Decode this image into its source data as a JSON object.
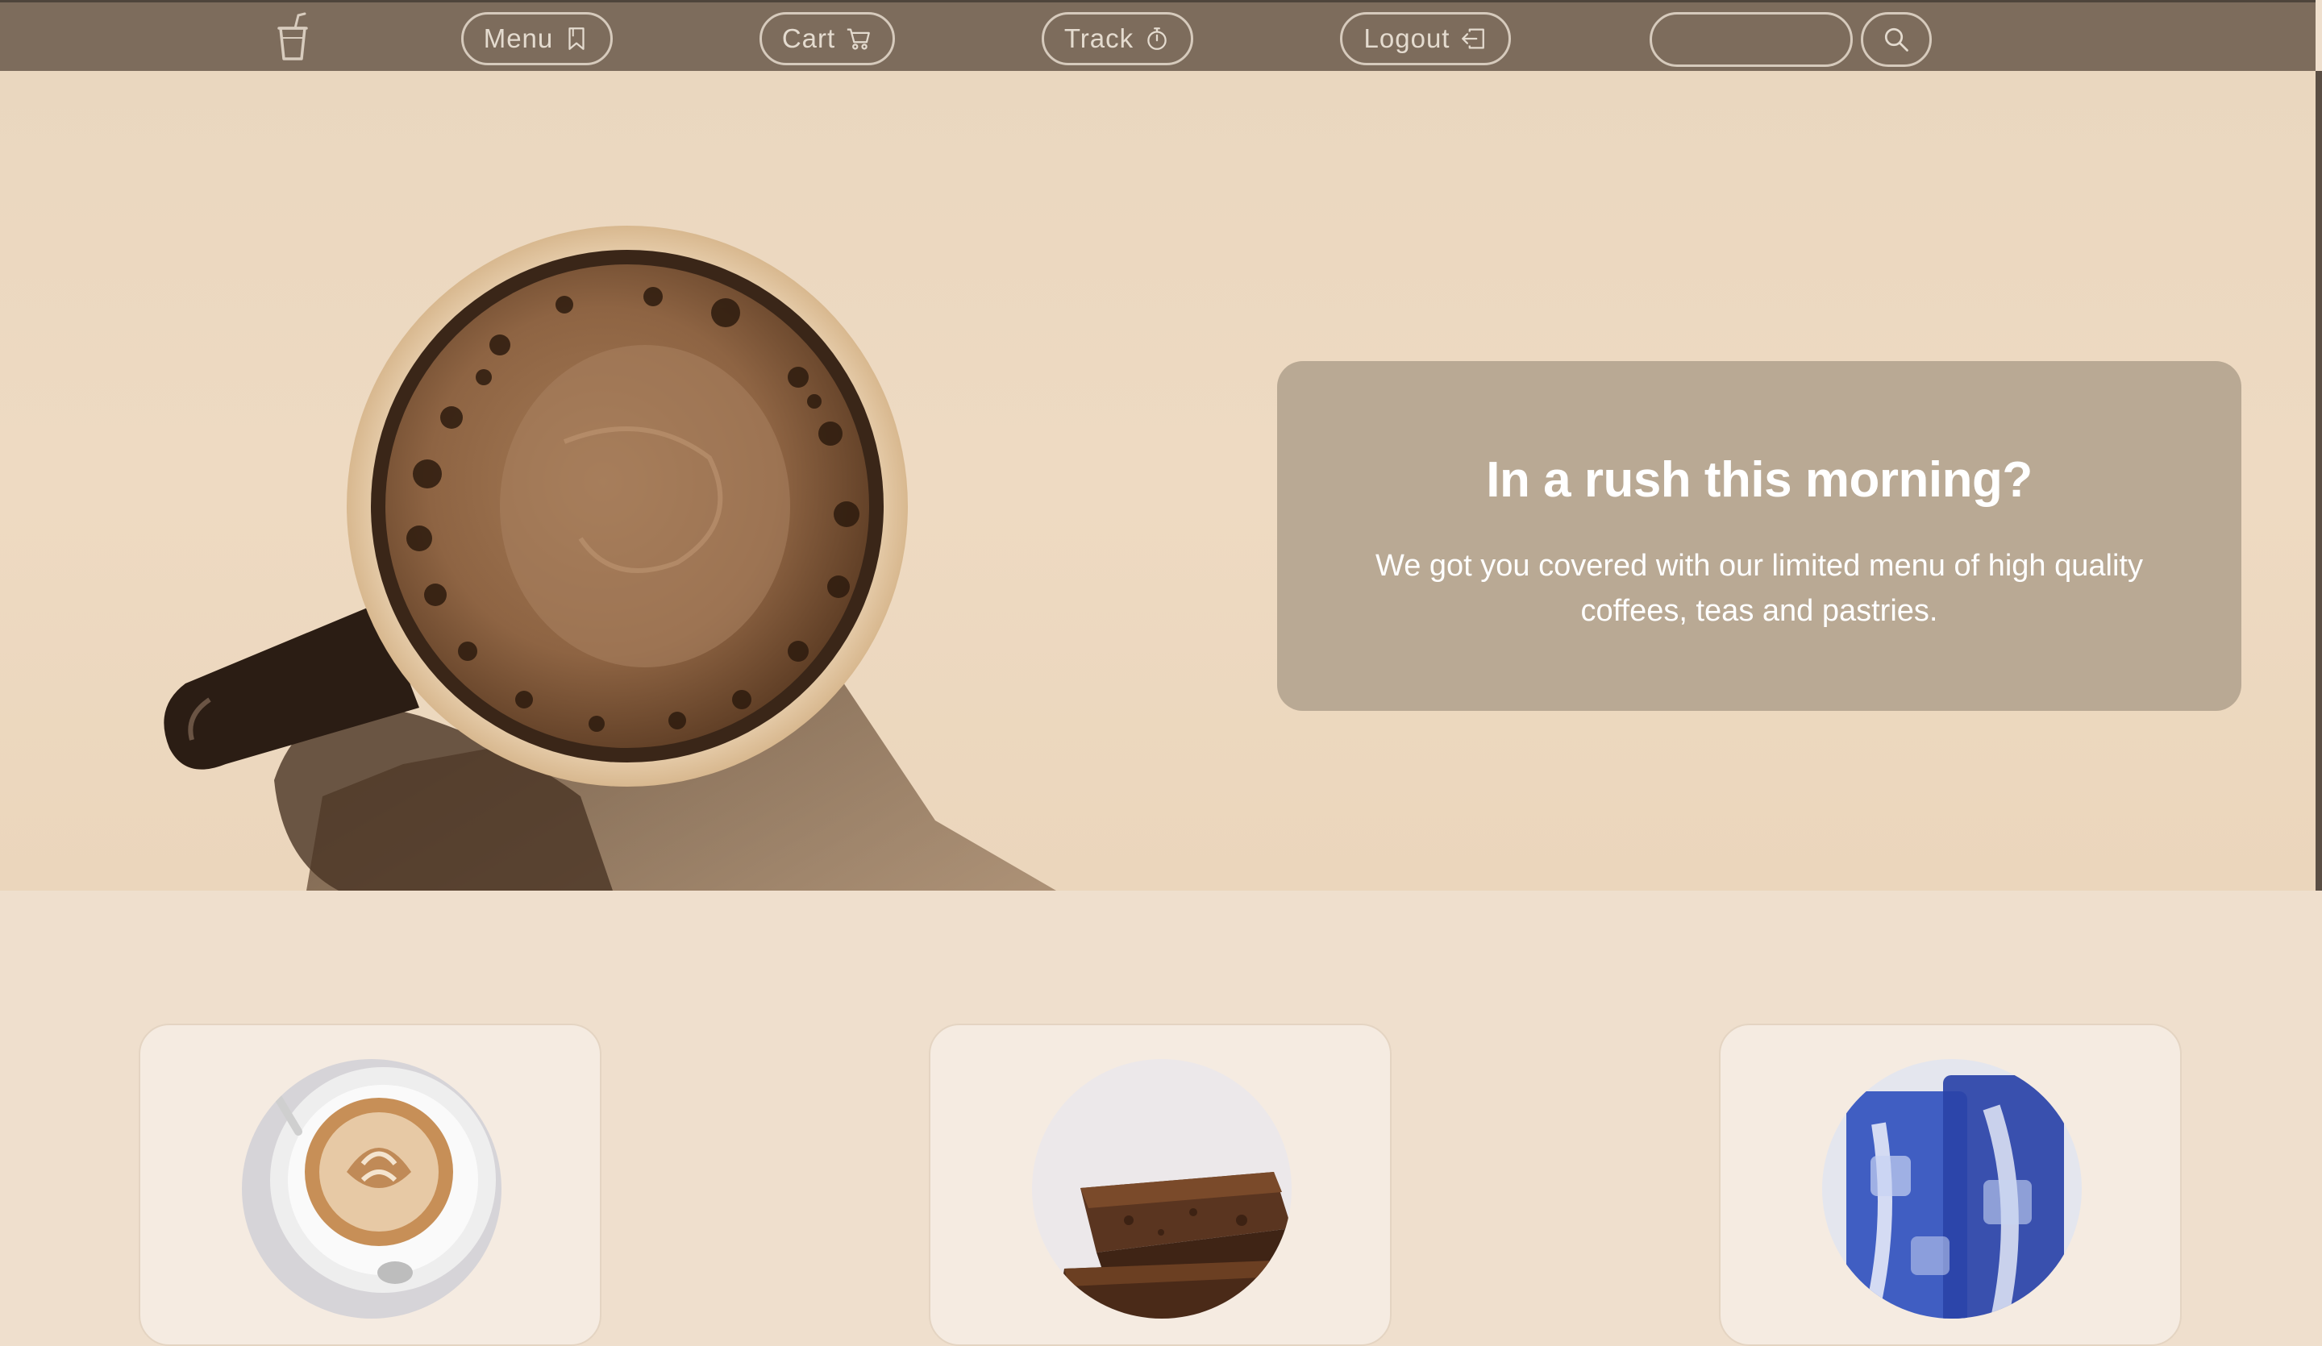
{
  "nav": {
    "logo_icon": "cup-with-straw-icon",
    "menu_label": "Menu",
    "menu_icon": "bookmark-icon",
    "cart_label": "Cart",
    "cart_icon": "cart-icon",
    "track_label": "Track",
    "track_icon": "stopwatch-icon",
    "logout_label": "Logout",
    "logout_icon": "box-arrow-left-icon",
    "search_value": "",
    "search_placeholder": "",
    "search_icon": "search-icon"
  },
  "hero": {
    "title": "In a rush this morning?",
    "text": "We got you covered with our limited menu of high quality coffees, teas and pastries.",
    "image": "coffee-mug-top-view"
  },
  "products": [
    {
      "image": "latte-art-cup"
    },
    {
      "image": "brownie-stack"
    },
    {
      "image": "butterfly-pea-iced-drink"
    }
  ],
  "colors": {
    "navbar": "#7d6c5c",
    "page_bg": "#efdfcd",
    "hero_card": "#b9a994",
    "card_bg": "#f5ebe1",
    "nav_outline": "#d6cabc"
  }
}
